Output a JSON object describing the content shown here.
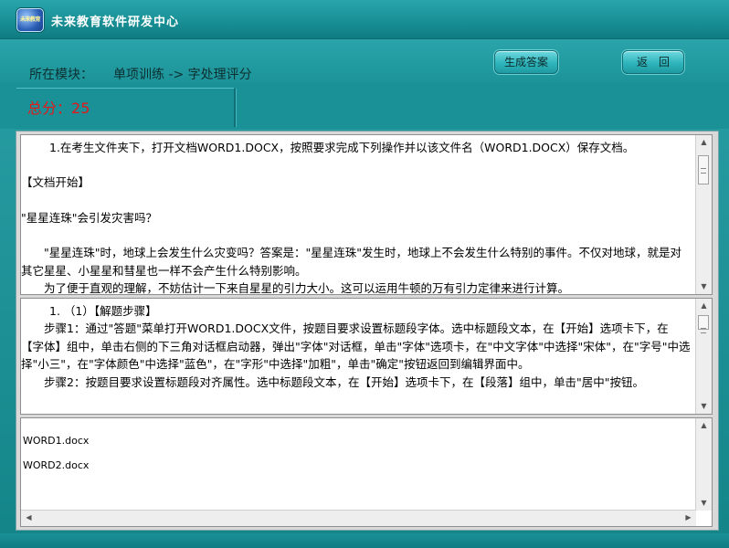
{
  "window": {
    "title": "未来教育软件研发中心",
    "logo_text": "未来教育"
  },
  "header": {
    "module_label": "所在模块：",
    "module_path": "单项训练 -> 字处理评分",
    "generate_answer_label": "生成答案",
    "back_label": "返　回"
  },
  "score": {
    "label": "总分：",
    "value": "25"
  },
  "question_pane": {
    "paragraphs": [
      "　　1.在考生文件夹下，打开文档WORD1.DOCX，按照要求完成下列操作并以该文件名（WORD1.DOCX）保存文档。",
      "",
      "【文档开始】",
      "",
      "\"星星连珠\"会引发灾害吗？",
      "",
      "　　\"星星连珠\"时，地球上会发生什么灾变吗？答案是：\"星星连珠\"发生时，地球上不会发生什么特别的事件。不仅对地球，就是对其它星星、小星星和彗星也一样不会产生什么特别影响。",
      "　　为了便于直观的理解，不妨估计一下来自星星的引力大小。这可以运用牛顿的万有引力定律来进行计算。"
    ]
  },
  "answer_pane": {
    "paragraphs": [
      "　　1. （1）【解题步骤】",
      "　　步骤1：通过\"答题\"菜单打开WORD1.DOCX文件，按题目要求设置标题段字体。选中标题段文本，在【开始】选项卡下，在【字体】组中，单击右侧的下三角对话框启动器，弹出\"字体\"对话框，单击\"字体\"选项卡，在\"中文字体\"中选择\"宋体\"，在\"字号\"中选择\"小三\"，在\"字体颜色\"中选择\"蓝色\"，在\"字形\"中选择\"加粗\"，单击\"确定\"按钮返回到编辑界面中。",
      "　　步骤2：按题目要求设置标题段对齐属性。选中标题段文本，在【开始】选项卡下，在【段落】组中，单击\"居中\"按钮。"
    ]
  },
  "files_pane": {
    "files": [
      "WORD1.docx",
      "WORD2.docx"
    ]
  },
  "colors": {
    "accent": "#1b9399",
    "score_red": "#e01a1a"
  }
}
